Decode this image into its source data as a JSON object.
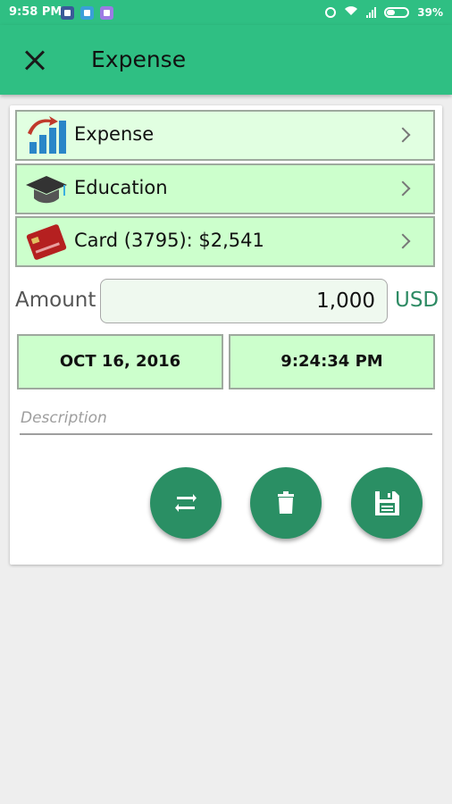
{
  "status_bar": {
    "time": "9:58 PM",
    "battery": "39%"
  },
  "app_bar": {
    "title": "Expense"
  },
  "rows": [
    {
      "label": "Expense"
    },
    {
      "label": "Education"
    },
    {
      "label": "Card (3795): $2,541"
    }
  ],
  "amount": {
    "label": "Amount",
    "value": "1,000",
    "currency": "USD"
  },
  "date": "OCT 16, 2016",
  "time": "9:24:34 PM",
  "description": {
    "placeholder": "Description"
  },
  "colors": {
    "primary": "#2fbf83",
    "accent": "#2a8f64",
    "row_bg": "#ccffcc"
  }
}
